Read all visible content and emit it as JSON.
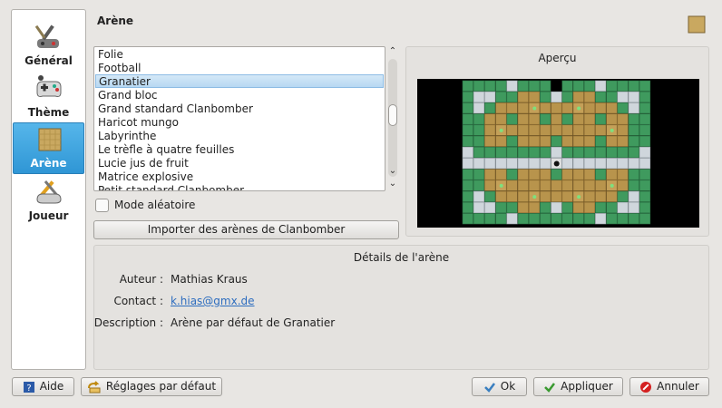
{
  "sidebar": {
    "items": [
      {
        "label": "Général",
        "icon": "general-tools-icon"
      },
      {
        "label": "Thème",
        "icon": "theme-gamepad-icon"
      },
      {
        "label": "Arène",
        "icon": "arena-icon"
      },
      {
        "label": "Joueur",
        "icon": "player-tools-icon"
      }
    ],
    "active_index": 2
  },
  "page": {
    "title": "Arène",
    "icon": "arena-icon"
  },
  "arena_list": {
    "items": [
      "Folie",
      "Football",
      "Granatier",
      "Grand bloc",
      "Grand standard Clanbomber",
      "Haricot mungo",
      "Labyrinthe",
      "Le trèfle à quatre feuilles",
      "Lucie jus de fruit",
      "Matrice explosive",
      "Petit standard Clanbomber"
    ],
    "selected": "Granatier"
  },
  "random_mode": {
    "label": "Mode aléatoire",
    "checked": false
  },
  "import_button": {
    "label": "Importer des arènes de Clanbomber"
  },
  "preview": {
    "title": "Aperçu"
  },
  "details": {
    "title": "Détails de l'arène",
    "author_label": "Auteur :",
    "author": "Mathias Kraus",
    "contact_label": "Contact :",
    "contact": "k.hias@gmx.de",
    "description_label": "Description :",
    "description": "Arène par défaut de Granatier"
  },
  "footer": {
    "help": "Aide",
    "defaults": "Réglages par défaut",
    "ok": "Ok",
    "apply": "Appliquer",
    "cancel": "Annuler"
  },
  "colors": {
    "selection": "#3daee9",
    "link": "#2d6dbf",
    "arena_bg": "#000000"
  }
}
